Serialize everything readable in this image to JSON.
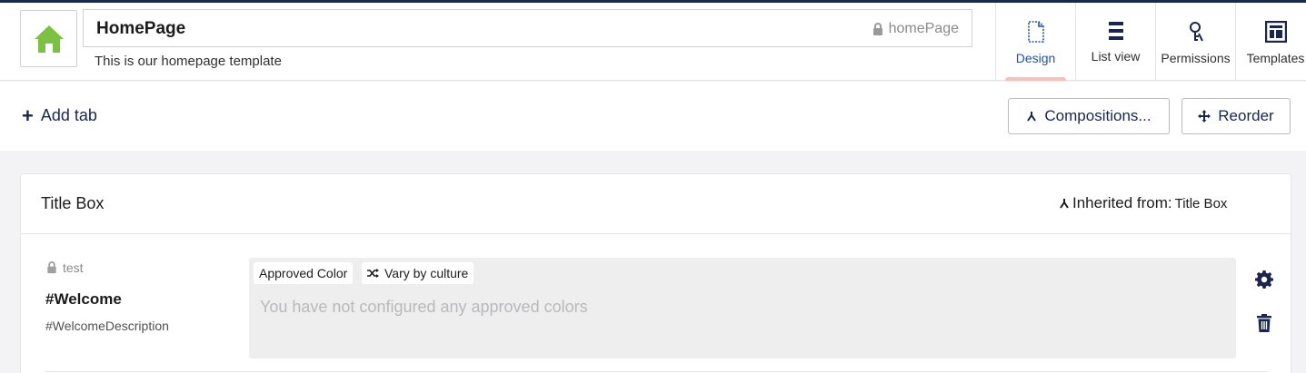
{
  "header": {
    "name": "HomePage",
    "alias": "homePage",
    "description": "This is our homepage template",
    "icon": "home-icon",
    "icon_color": "#7cc242"
  },
  "apps": [
    {
      "label": "Design",
      "icon": "design-icon",
      "active": true
    },
    {
      "label": "List view",
      "icon": "list-view-icon",
      "active": false
    },
    {
      "label": "Permissions",
      "icon": "permissions-icon",
      "active": false
    },
    {
      "label": "Templates",
      "icon": "templates-icon",
      "active": false
    }
  ],
  "toolbar": {
    "add_tab": "Add tab",
    "compositions": "Compositions...",
    "reorder": "Reorder"
  },
  "group": {
    "title": "Title Box",
    "inherited_label": "Inherited from:",
    "inherited_source": "Title Box",
    "property": {
      "lock_label": "test",
      "label": "#Welcome",
      "alias": "#WelcomeDescription",
      "editor_tag": "Approved Color",
      "variant_tag": "Vary by culture",
      "placeholder": "You have not configured any approved colors"
    }
  },
  "colors": {
    "accent": "#1b264f",
    "active_app": "#2152a3",
    "active_bar": "#f5c1bc"
  }
}
